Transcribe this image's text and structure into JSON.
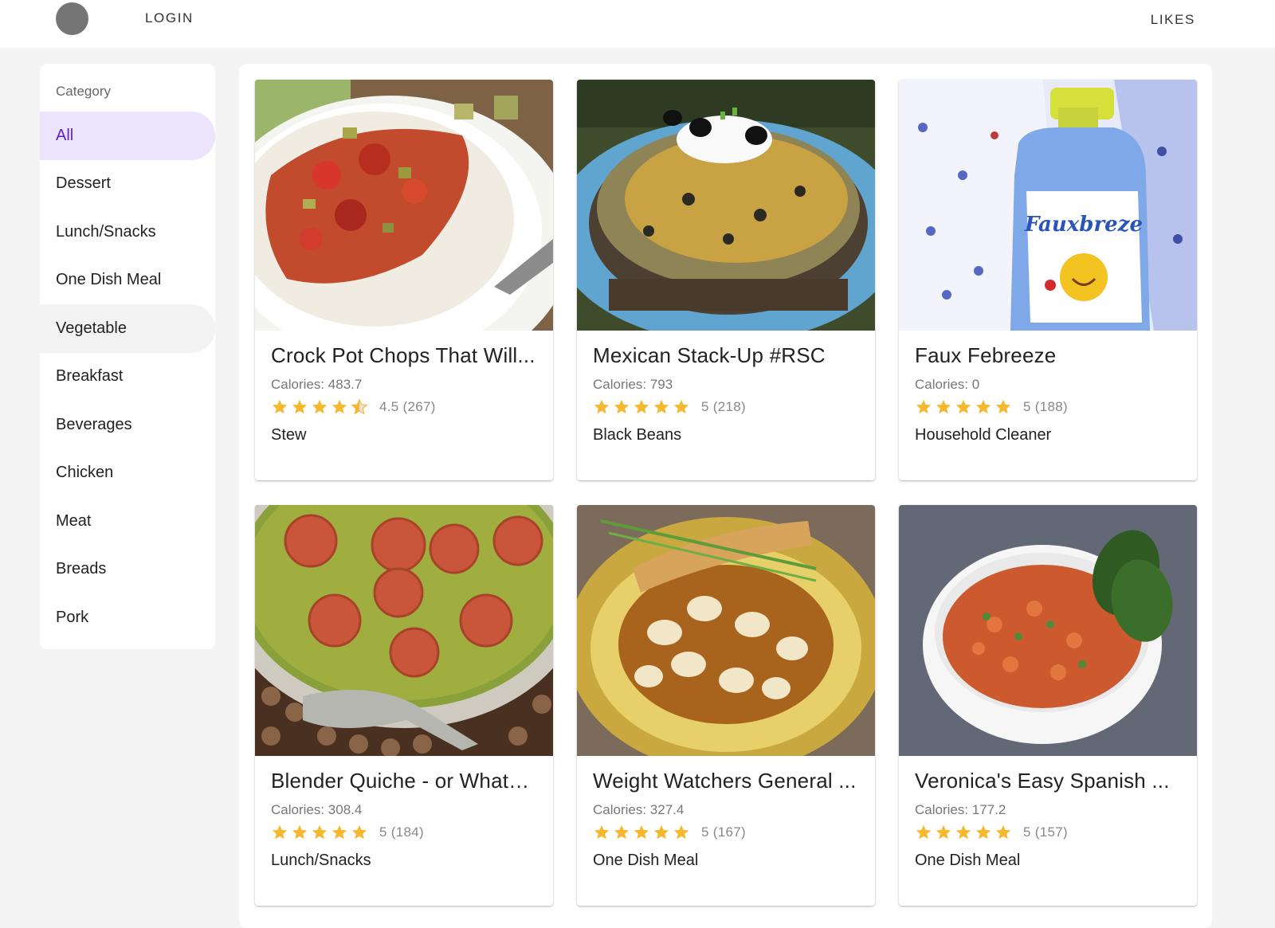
{
  "header": {
    "login_label": "LOGIN",
    "likes_label": "LIKES"
  },
  "sidebar": {
    "title": "Category",
    "items": [
      {
        "label": "All",
        "selected": true
      },
      {
        "label": "Dessert"
      },
      {
        "label": "Lunch/Snacks"
      },
      {
        "label": "One Dish Meal"
      },
      {
        "label": "Vegetable",
        "hovered": true
      },
      {
        "label": "Breakfast"
      },
      {
        "label": "Beverages"
      },
      {
        "label": "Chicken"
      },
      {
        "label": "Meat"
      },
      {
        "label": "Breads"
      },
      {
        "label": "Pork"
      }
    ]
  },
  "recipes": [
    {
      "title": "Crock Pot Chops That Will Knock Your Socks Off",
      "display_title": "Crock Pot Chops That Will...",
      "calories": "Calories: 483.7",
      "rating": 4.5,
      "rating_text": "4.5 (267)",
      "category": "Stew",
      "image": "pork-chops-with-salsa-on-rice"
    },
    {
      "title": "Mexican Stack-Up #RSC",
      "display_title": "Mexican Stack-Up #RSC",
      "calories": "Calories: 793",
      "rating": 5,
      "rating_text": "5 (218)",
      "category": "Black Beans",
      "image": "layered-tortilla-casserole-with-sour-cream-and-olives"
    },
    {
      "title": "Faux Febreeze",
      "display_title": "Faux Febreeze",
      "calories": "Calories: 0",
      "rating": 5,
      "rating_text": "5 (188)",
      "category": "Household Cleaner",
      "image": "spray-bottle-labelled-fauxbreze",
      "image_label": "Fauxbreze"
    },
    {
      "title": "Blender Quiche - or Whatever",
      "display_title": "Blender Quiche - or Whate...",
      "calories": "Calories: 308.4",
      "rating": 5,
      "rating_text": "5 (184)",
      "category": "Lunch/Snacks",
      "image": "spinach-quiche-topped-with-tomato-slices"
    },
    {
      "title": "Weight Watchers General Tso's Chicken",
      "display_title": "Weight Watchers General ...",
      "calories": "Calories: 327.4",
      "rating": 5,
      "rating_text": "5 (167)",
      "category": "One Dish Meal",
      "image": "glazed-chicken-with-egg-roll-on-yellow-plate"
    },
    {
      "title": "Veronica's Easy Spanish Rice",
      "display_title": "Veronica's Easy Spanish ...",
      "calories": "Calories: 177.2",
      "rating": 5,
      "rating_text": "5 (157)",
      "category": "One Dish Meal",
      "image": "spanish-rice-in-white-bowl-with-basil"
    }
  ],
  "colors": {
    "accent": "#5a1fd6",
    "selected_bg": "#ece4fd",
    "star": "#f5b82e",
    "star_empty": "#e2e2e2"
  }
}
